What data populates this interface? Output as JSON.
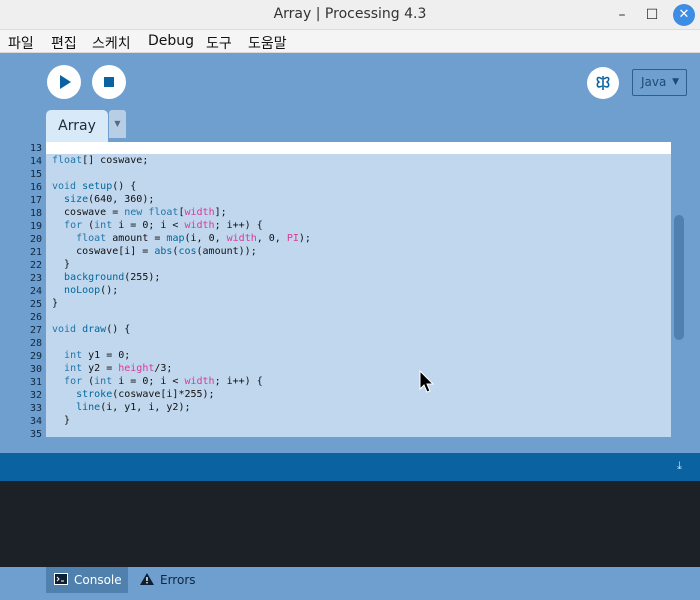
{
  "window": {
    "title": "Array | Processing 4.3",
    "minimize_glyph": "–",
    "maximize_glyph": "☐",
    "close_glyph": "✕"
  },
  "menu": [
    "파일",
    "편집",
    "스케치",
    "Debug",
    "도구",
    "도움말"
  ],
  "toolbar": {
    "run_icon": "play-icon",
    "stop_icon": "stop-icon",
    "debug_icon": "butterfly-debug-icon",
    "mode_label": "Java",
    "mode_arrow": "▼"
  },
  "tabs": {
    "active_label": "Array",
    "menu_arrow": "▼"
  },
  "editor": {
    "line_numbers": [
      "13",
      "14",
      "15",
      "16",
      "17",
      "18",
      "19",
      "20",
      "21",
      "22",
      "23",
      "24",
      "25",
      "26",
      "27",
      "28",
      "29",
      "30",
      "31",
      "32",
      "33",
      "34",
      "35"
    ],
    "lines": [
      [
        {
          "t": "float",
          "c": "ty"
        },
        {
          "t": "[] coswave;",
          "c": ""
        }
      ],
      [],
      [
        {
          "t": "void",
          "c": "kw"
        },
        {
          "t": " ",
          "c": ""
        },
        {
          "t": "setup",
          "c": "fn"
        },
        {
          "t": "() {",
          "c": ""
        }
      ],
      [
        {
          "t": "  ",
          "c": ""
        },
        {
          "t": "size",
          "c": "fn"
        },
        {
          "t": "(640, 360);",
          "c": ""
        }
      ],
      [
        {
          "t": "  coswave = ",
          "c": ""
        },
        {
          "t": "new",
          "c": "kw"
        },
        {
          "t": " ",
          "c": ""
        },
        {
          "t": "float",
          "c": "ty"
        },
        {
          "t": "[",
          "c": ""
        },
        {
          "t": "width",
          "c": "bi"
        },
        {
          "t": "];",
          "c": ""
        }
      ],
      [
        {
          "t": "  ",
          "c": ""
        },
        {
          "t": "for",
          "c": "kw"
        },
        {
          "t": " (",
          "c": ""
        },
        {
          "t": "int",
          "c": "ty"
        },
        {
          "t": " i = 0; i < ",
          "c": ""
        },
        {
          "t": "width",
          "c": "bi"
        },
        {
          "t": "; i++) {",
          "c": ""
        }
      ],
      [
        {
          "t": "    ",
          "c": ""
        },
        {
          "t": "float",
          "c": "ty"
        },
        {
          "t": " amount = ",
          "c": ""
        },
        {
          "t": "map",
          "c": "fn"
        },
        {
          "t": "(i, 0, ",
          "c": ""
        },
        {
          "t": "width",
          "c": "bi"
        },
        {
          "t": ", 0, ",
          "c": ""
        },
        {
          "t": "PI",
          "c": "bi"
        },
        {
          "t": ");",
          "c": ""
        }
      ],
      [
        {
          "t": "    coswave[i] = ",
          "c": ""
        },
        {
          "t": "abs",
          "c": "fn"
        },
        {
          "t": "(",
          "c": ""
        },
        {
          "t": "cos",
          "c": "fn"
        },
        {
          "t": "(amount));",
          "c": ""
        }
      ],
      [
        {
          "t": "  }",
          "c": ""
        }
      ],
      [
        {
          "t": "  ",
          "c": ""
        },
        {
          "t": "background",
          "c": "fn"
        },
        {
          "t": "(255);",
          "c": ""
        }
      ],
      [
        {
          "t": "  ",
          "c": ""
        },
        {
          "t": "noLoop",
          "c": "fn"
        },
        {
          "t": "();",
          "c": ""
        }
      ],
      [
        {
          "t": "}",
          "c": ""
        }
      ],
      [],
      [
        {
          "t": "void",
          "c": "kw"
        },
        {
          "t": " ",
          "c": ""
        },
        {
          "t": "draw",
          "c": "fn"
        },
        {
          "t": "() {",
          "c": ""
        }
      ],
      [],
      [
        {
          "t": "  ",
          "c": ""
        },
        {
          "t": "int",
          "c": "ty"
        },
        {
          "t": " y1 = 0;",
          "c": ""
        }
      ],
      [
        {
          "t": "  ",
          "c": ""
        },
        {
          "t": "int",
          "c": "ty"
        },
        {
          "t": " y2 = ",
          "c": ""
        },
        {
          "t": "height",
          "c": "bi"
        },
        {
          "t": "/3;",
          "c": ""
        }
      ],
      [
        {
          "t": "  ",
          "c": ""
        },
        {
          "t": "for",
          "c": "kw"
        },
        {
          "t": " (",
          "c": ""
        },
        {
          "t": "int",
          "c": "ty"
        },
        {
          "t": " i = 0; i < ",
          "c": ""
        },
        {
          "t": "width",
          "c": "bi"
        },
        {
          "t": "; i++) {",
          "c": ""
        }
      ],
      [
        {
          "t": "    ",
          "c": ""
        },
        {
          "t": "stroke",
          "c": "fn"
        },
        {
          "t": "(coswave[i]*255);",
          "c": ""
        }
      ],
      [
        {
          "t": "    ",
          "c": ""
        },
        {
          "t": "line",
          "c": "fn"
        },
        {
          "t": "(i, y1, i, y2);",
          "c": ""
        }
      ],
      [
        {
          "t": "  }",
          "c": ""
        }
      ]
    ]
  },
  "console": {
    "scroll_icon": "scroll-down-icon",
    "scroll_glyph": "⤓",
    "console_tab_label": "Console",
    "errors_tab_label": "Errors"
  },
  "colors": {
    "ui_blue": "#6e9fcf",
    "code_bg": "#c0d7ee",
    "console_header": "#0b62a0",
    "console_bg": "#1c2127"
  }
}
